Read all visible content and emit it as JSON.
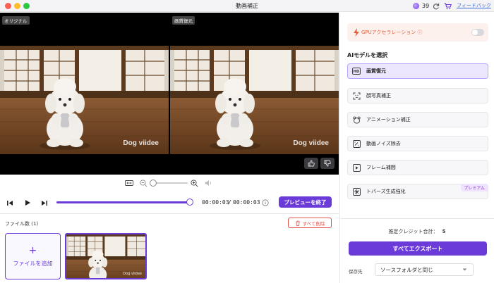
{
  "window": {
    "title": "動画補正",
    "credits": "39",
    "feedback": "フィードバック"
  },
  "video": {
    "left_label": "オリジナル",
    "right_label": "画質復元",
    "watermark": "Dog viidee"
  },
  "playback": {
    "current_time": "00:00:03",
    "separator": "/",
    "total_time": "00:00:03",
    "progress": 1.0,
    "preview_end_label": "プレビューを終了"
  },
  "files": {
    "count_label": "ファイル数 (1)",
    "delete_all_label": "すべて削除",
    "add_file_plus": "+",
    "add_file_label": "ファイルを追加",
    "thumb_watermark": "Dog viidee"
  },
  "panel": {
    "gpu_label": "GPUアクセラレーション",
    "gpu_enabled": false,
    "models_title": "AIモデルを選択",
    "models": [
      {
        "label": "画質復元",
        "icon": "hd-icon",
        "selected": true
      },
      {
        "label": "顔写真補正",
        "icon": "face-scan-icon"
      },
      {
        "label": "アニメーション補正",
        "icon": "bear-icon"
      },
      {
        "label": "動画ノイズ除去",
        "icon": "denoise-icon"
      },
      {
        "label": "フレーム補間",
        "icon": "frame-interp-icon"
      },
      {
        "label": "トバーズ生成強化",
        "icon": "sparkle-icon",
        "badge": "プレミアム"
      }
    ],
    "credit_total_label": "推定クレジット合計：",
    "credit_total_value": "5",
    "export_label": "すべてエクスポート",
    "save_to_label": "保存先",
    "save_to_value": "ソースフォルダと同じ"
  },
  "colors": {
    "accent": "#6a3bd9",
    "danger": "#e0524a",
    "gpu_text": "#e06040"
  }
}
